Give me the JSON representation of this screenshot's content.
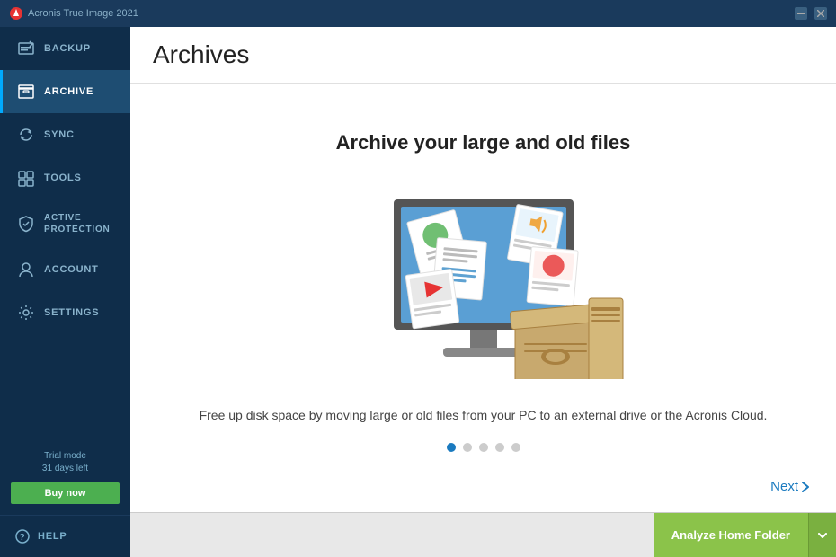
{
  "topbar": {
    "logo_text": "Acronis True Image 2021"
  },
  "sidebar": {
    "items": [
      {
        "id": "backup",
        "label": "BACKUP",
        "icon": "backup-icon"
      },
      {
        "id": "archive",
        "label": "ARCHIVE",
        "icon": "archive-icon",
        "active": true
      },
      {
        "id": "sync",
        "label": "SYNC",
        "icon": "sync-icon"
      },
      {
        "id": "tools",
        "label": "TOOLS",
        "icon": "tools-icon"
      },
      {
        "id": "active-protection",
        "label": "ACTIVE PROTECTION",
        "icon": "protection-icon"
      },
      {
        "id": "account",
        "label": "ACCOUNT",
        "icon": "account-icon"
      },
      {
        "id": "settings",
        "label": "SETTINGS",
        "icon": "settings-icon"
      }
    ],
    "trial_line1": "Trial mode",
    "trial_line2": "31 days left",
    "buy_now_label": "Buy now",
    "help_label": "HELP"
  },
  "content": {
    "header_title": "Archives",
    "main_title": "Archive your large and old files",
    "description": "Free up disk space by moving large or old files from your PC to an external drive or the Acronis Cloud.",
    "dots_count": 5,
    "active_dot": 0,
    "next_label": "Next",
    "analyze_home_folder_label": "Analyze Home Folder"
  },
  "colors": {
    "sidebar_bg": "#0f2d4a",
    "active_item_bg": "#1e4d72",
    "accent_blue": "#1a7abf",
    "green": "#8bc34a",
    "monitor_frame": "#555555",
    "monitor_screen": "#4a90c8"
  }
}
